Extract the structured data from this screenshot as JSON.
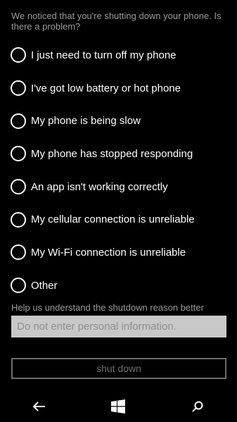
{
  "prompt": "We noticed that you're shutting down your phone. Is there a problem?",
  "options": [
    {
      "label": "I just need to turn off my phone"
    },
    {
      "label": "I've got low battery or hot phone"
    },
    {
      "label": "My phone is being slow"
    },
    {
      "label": "My phone has stopped responding"
    },
    {
      "label": "An app isn't working correctly"
    },
    {
      "label": "My cellular connection is unreliable"
    },
    {
      "label": "My Wi-Fi connection is unreliable"
    },
    {
      "label": "Other"
    }
  ],
  "reason": {
    "hint": "Help us understand the shutdown reason better",
    "placeholder": "Do not enter personal information."
  },
  "shutdown_label": "shut down",
  "navbar": {
    "back_icon": "back-arrow-icon",
    "home_icon": "windows-logo-icon",
    "search_icon": "search-icon"
  },
  "colors": {
    "background": "#000000",
    "text": "#ffffff",
    "muted_text": "#9a9a9a",
    "input_bg": "#c8c8c8",
    "disabled": "#6e6e6e"
  }
}
